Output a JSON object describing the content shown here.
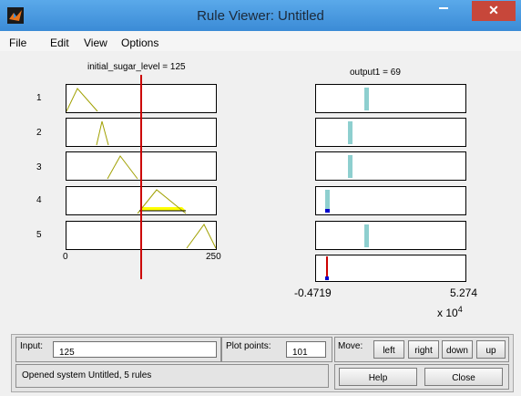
{
  "window": {
    "title": "Rule Viewer: Untitled"
  },
  "menu": [
    "File",
    "Edit",
    "View",
    "Options"
  ],
  "input_header": "initial_sugar_level = 125",
  "output_header": "output1 = 69",
  "rules": [
    "1",
    "2",
    "3",
    "4",
    "5"
  ],
  "input_axis": {
    "min": "0",
    "max": "250"
  },
  "output_axis": {
    "min": "-0.4719",
    "max": "5.274",
    "multiplier": "x 10",
    "exponent": "4"
  },
  "controls": {
    "input_label": "Input:",
    "input_value": "125",
    "plot_points_label": "Plot points:",
    "plot_points_value": "101",
    "move_label": "Move:",
    "left": "left",
    "right": "right",
    "down": "down",
    "up": "up",
    "help": "Help",
    "close": "Close"
  },
  "status": "Opened system Untitled, 5 rules",
  "colors": {
    "mf_line": "#a0a000",
    "fill_yellow": "#ffff00",
    "cursor": "#cc0000",
    "output_bar": "#8ecfcf",
    "output_marker": "#0000cc"
  }
}
